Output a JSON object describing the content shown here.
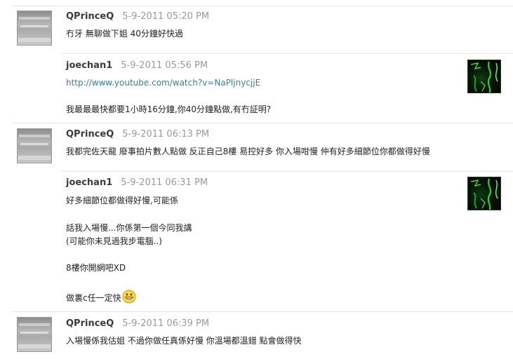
{
  "posts": [
    {
      "user": "QPrinceQ",
      "date": "5-9-2011 05:20 PM",
      "lines": [
        "冇牙 無聊做下姐 40分鐘好快過"
      ]
    },
    {
      "user": "joechan1",
      "date": "5-9-2011 05:56 PM",
      "link": "http://www.youtube.com/watch?v=NaPljnycjjE",
      "lines": [
        "我最最最快都要1小時16分鐘,你40分鐘點做,有冇証明?"
      ]
    },
    {
      "user": "QPrinceQ",
      "date": "5-9-2011 06:13 PM",
      "lines": [
        "我都完佐天龍 廢事拍片數人點做 反正自己8樓 易控好多 你入場咁慢 仲有好多細節位你都做得好慢"
      ]
    },
    {
      "user": "joechan1",
      "date": "5-9-2011 06:31 PM",
      "lines": [
        "好多細節位都做得好慢,可能係",
        "話我入場慢...你係第一個今同我講",
        "(可能你未見過我步電腦..)",
        "8樓你開網吧XD",
        "做裏c任一定快"
      ]
    },
    {
      "user": "QPrinceQ",
      "date": "5-9-2011 06:39 PM",
      "lines": [
        "入場慢係我估姐 不過你做任真係好慢 你溫場都溫錯 點會做得快"
      ]
    }
  ],
  "icons": {
    "avatar_gray": "avatar-image",
    "avatar_green": "avatar-image",
    "smiley": "grin-emoticon-icon"
  },
  "colors": {
    "link": "#2c7fb8",
    "date": "#9a9a9a",
    "username": "#3b3b3b",
    "divider": "#e3e3e3"
  }
}
